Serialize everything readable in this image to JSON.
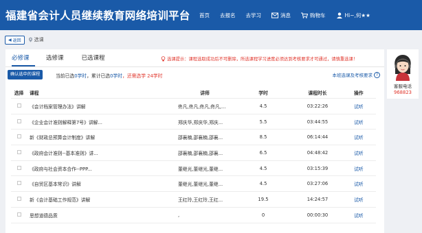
{
  "app": {
    "title": "福建省会计人员继续教育网络培训平台",
    "nav": [
      {
        "label": "首页",
        "icon": ""
      },
      {
        "label": "去报名",
        "icon": ""
      },
      {
        "label": "去学习",
        "icon": ""
      },
      {
        "label": "消息",
        "icon": "mail-icon"
      },
      {
        "label": "购物车",
        "icon": "cart-icon"
      },
      {
        "label": "Hi~,何★★",
        "icon": "user-icon"
      }
    ]
  },
  "subbar": {
    "back_label": "返回",
    "breadcrumb": "选课"
  },
  "tabs": [
    "必修课",
    "选修课",
    "已选课程"
  ],
  "tip": "选课提示：课程选取成功后不可删除，所选课程学习进度必须达到考核要求才可通过，请慎重选课！",
  "toolbar": {
    "confirm_label": "确认选中的课程",
    "summary_prefix": "当前已选",
    "summary_selected": "0学时",
    "summary_mid": "，累计已选",
    "summary_total": "0学时",
    "summary_sep": "，",
    "summary_remaining": "还需选学 24学时",
    "requirement_label": "本班选课及考核要求",
    "requirement_icon": "?"
  },
  "table": {
    "headers": [
      "选择",
      "课程",
      "讲师",
      "学时",
      "课程时长",
      "操作"
    ],
    "rows": [
      {
        "course": "《会计档案管理办法》讲解",
        "teacher": "佟凡,佟凡,佟凡,佟凡,...",
        "hours": "4.5",
        "length": "03:22:26",
        "action": "试听"
      },
      {
        "course": "《企业会计准则解释第7号》讲解...",
        "teacher": "郑庆华,郑庆华,郑庆...",
        "hours": "5.5",
        "length": "03:44:55",
        "action": "试听"
      },
      {
        "course": "新《财政总预算会计制度》讲解",
        "teacher": "邵襄楠,邵襄楠,邵襄...",
        "hours": "8.5",
        "length": "06:14:44",
        "action": "试听"
      },
      {
        "course": "《政府会计准则--基本准则》讲...",
        "teacher": "邵襄楠,邵襄楠,邵襄...",
        "hours": "6.5",
        "length": "04:48:42",
        "action": "试听"
      },
      {
        "course": "《政府与社会资本合作--PPP...",
        "teacher": "董继光,董继光,董继...",
        "hours": "4.5",
        "length": "03:15:39",
        "action": "试听"
      },
      {
        "course": "《自贸区基本常识》讲解",
        "teacher": "董继光,董继光,董继...",
        "hours": "4.5",
        "length": "03:27:06",
        "action": "试听"
      },
      {
        "course": "新《会计基础工作规范》讲解",
        "teacher": "王红玲,王红玲,王红...",
        "hours": "19.5",
        "length": "14:24:57",
        "action": "试听"
      },
      {
        "course": "思想道德品质",
        "teacher": ",",
        "hours": "0",
        "length": "00:00:30",
        "action": "试听"
      }
    ]
  },
  "service": {
    "label": "客服电话",
    "phone": "968823"
  },
  "colors": {
    "brand": "#1a5aa8",
    "alert": "#e0342a"
  }
}
